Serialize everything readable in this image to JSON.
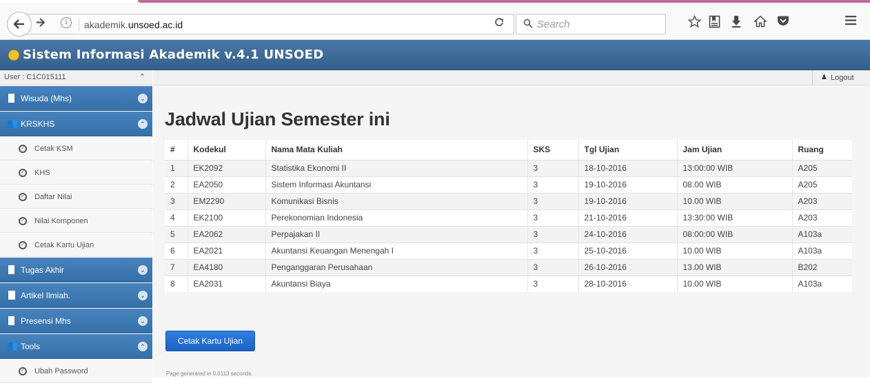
{
  "browser": {
    "url_host": "akademik.",
    "url_domain": "unsoed.ac.id",
    "search_placeholder": "Search"
  },
  "header": {
    "title": "Sistem Informasi Akademik v.4.1 UNSOED"
  },
  "sidebar": {
    "user_label": "User : C1C015111",
    "menu": [
      {
        "label": "Wisuda (Mhs)",
        "expanded": false
      },
      {
        "label": "KRSKHS",
        "expanded": true
      },
      {
        "label": "Tugas Akhir",
        "expanded": false
      },
      {
        "label": "Artikel Ilmiah.",
        "expanded": false
      },
      {
        "label": "Presensi Mhs",
        "expanded": false
      },
      {
        "label": "Tools",
        "expanded": true
      }
    ],
    "krskhs_items": [
      "Cetak KSM",
      "KHS",
      "Daftar Nilai",
      "Nilai Komponen",
      "Cetak Kartu Ujian"
    ],
    "tools_items": [
      "Ubah Password"
    ]
  },
  "topbar": {
    "logout_label": "Logout"
  },
  "main": {
    "page_title": "Jadwal Ujian Semester ini",
    "table": {
      "headers": [
        "#",
        "Kodekul",
        "Nama Mata Kuliah",
        "SKS",
        "Tgl Ujian",
        "Jam Ujian",
        "Ruang"
      ],
      "rows": [
        [
          "1",
          "EK2092",
          "Statistika Ekonomi II",
          "3",
          "18-10-2016",
          "13:00:00 WIB",
          "A205"
        ],
        [
          "2",
          "EA2050",
          "Sistem Informasi Akuntansi",
          "3",
          "19-10-2016",
          "08.00 WIB",
          "A205"
        ],
        [
          "3",
          "EM2290",
          "Komunikasi Bisnis",
          "3",
          "19-10-2016",
          "10.00 WIB",
          "A203"
        ],
        [
          "4",
          "EK2100",
          "Perekonomian Indonesia",
          "3",
          "21-10-2016",
          "13:30:00 WIB",
          "A203"
        ],
        [
          "5",
          "EA2062",
          "Perpajakan II",
          "3",
          "24-10-2016",
          "08:00:00 WIB",
          "A103a"
        ],
        [
          "6",
          "EA2021",
          "Akuntansi Keuangan Menengah I",
          "3",
          "25-10-2016",
          "10.00 WIB",
          "A103a"
        ],
        [
          "7",
          "EA4180",
          "Penganggaran Perusahaan",
          "3",
          "26-10-2016",
          "13.00 WIB",
          "B202"
        ],
        [
          "8",
          "EA2031",
          "Akuntansi Biaya",
          "3",
          "28-10-2016",
          "10.00 WIB",
          "A103a"
        ]
      ]
    },
    "print_button": "Cetak Kartu Ujian",
    "footer_note": "Page generated in 0.0113 seconds."
  }
}
